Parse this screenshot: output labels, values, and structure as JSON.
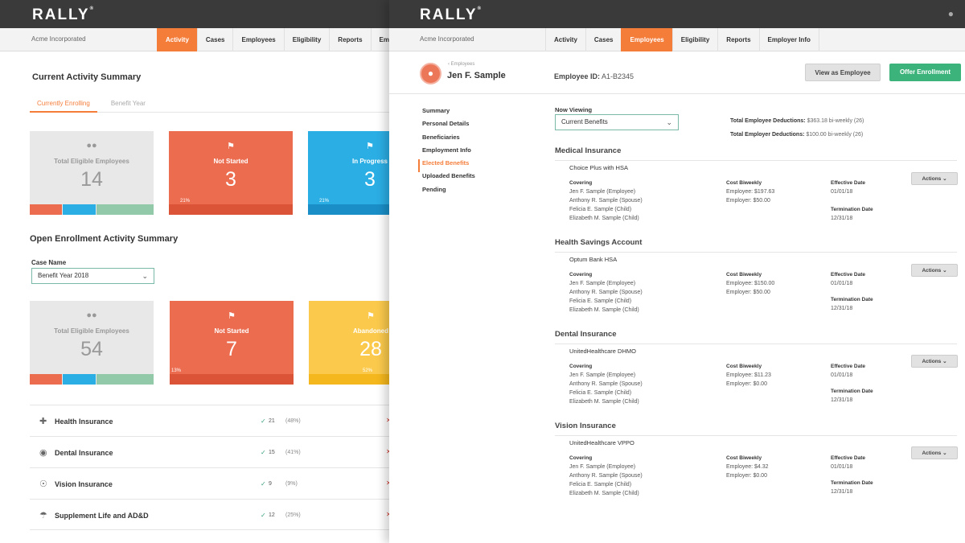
{
  "left": {
    "logo": "RALLY",
    "company": "Acme Incorporated",
    "tabs": [
      "Activity",
      "Cases",
      "Employees",
      "Eligibility",
      "Reports",
      "Emplo"
    ],
    "active_tab": 0,
    "title": "Current Activity Summary",
    "subtabs": [
      "Currently Enrolling",
      "Benefit Year"
    ],
    "cards_top": [
      {
        "label": "Total Eligible Employees",
        "value": "14",
        "icon": "people-icon"
      },
      {
        "label": "Not Started",
        "value": "3",
        "pct": "21%",
        "icon": "flag-icon"
      },
      {
        "label": "In Progress",
        "value": "3",
        "pct": "21%",
        "icon": "flag-icon"
      }
    ],
    "title2": "Open Enrollment Activity Summary",
    "case_label": "Case Name",
    "case_value": "Benefit Year 2018",
    "cards_bottom": [
      {
        "label": "Total Eligible Employees",
        "value": "54",
        "icon": "people-icon"
      },
      {
        "label": "Not Started",
        "value": "7",
        "pct": "13%",
        "icon": "flag-icon"
      },
      {
        "label": "Abandoned",
        "value": "28",
        "pct": "52%",
        "icon": "flag-icon"
      }
    ],
    "benefits": [
      {
        "name": "Health Insurance",
        "count": "21",
        "pct": "(48%)",
        "icon": "health-cross-icon"
      },
      {
        "name": "Dental Insurance",
        "count": "15",
        "pct": "(41%)",
        "icon": "tooth-icon"
      },
      {
        "name": "Vision Insurance",
        "count": "9",
        "pct": "(9%)",
        "icon": "eye-icon"
      },
      {
        "name": "Supplement Life and AD&D",
        "count": "12",
        "pct": "(25%)",
        "icon": "umbrella-icon"
      }
    ]
  },
  "right": {
    "logo": "RALLY",
    "company": "Acme Incorporated",
    "tabs": [
      "Activity",
      "Cases",
      "Employees",
      "Eligibility",
      "Reports",
      "Employer Info"
    ],
    "active_tab": 2,
    "breadcrumb": "Employees",
    "employee_name": "Jen F. Sample",
    "employee_id_label": "Employee ID:",
    "employee_id": "A1-B2345",
    "view_button": "View as Employee",
    "offer_button": "Offer Enrollment",
    "side_nav": [
      "Summary",
      "Personal Details",
      "Beneficiaries",
      "Employment Info",
      "Elected Benefits",
      "Uploaded Benefits",
      "Pending"
    ],
    "side_active": 4,
    "now_viewing_label": "Now Viewing",
    "now_viewing_value": "Current Benefits",
    "employee_deductions_label": "Total Employee Deductions:",
    "employee_deductions_value": "$363.18 bi-weekly (26)",
    "employer_deductions_label": "Total Employer Deductions:",
    "employer_deductions_value": "$100.00 bi-weekly (26)",
    "col_covering": "Covering",
    "col_cost": "Cost Biweekly",
    "col_effective": "Effective Date",
    "col_termination": "Termination Date",
    "actions_label": "Actions",
    "sections": [
      {
        "title": "Medical Insurance",
        "plan": "Choice Plus with HSA",
        "covering": [
          "Jen F. Sample (Employee)",
          "Anthony R. Sample (Spouse)",
          "Felicia E. Sample (Child)",
          "Elizabeth M. Sample (Child)"
        ],
        "cost_employee": "Employee: $197.63",
        "cost_employer": "Employer: $50.00",
        "effective": "01/01/18",
        "termination": "12/31/18"
      },
      {
        "title": "Health Savings Account",
        "plan": "Optum Bank HSA",
        "covering": [
          "Jen F. Sample (Employee)",
          "Anthony R. Sample (Spouse)",
          "Felicia E. Sample (Child)",
          "Elizabeth M. Sample (Child)"
        ],
        "cost_employee": "Employee: $150.00",
        "cost_employer": "Employer: $50.00",
        "effective": "01/01/18",
        "termination": "12/31/18"
      },
      {
        "title": "Dental Insurance",
        "plan": "UnitedHealthcare DHMO",
        "covering": [
          "Jen F. Sample (Employee)",
          "Anthony R. Sample (Spouse)",
          "Felicia E. Sample (Child)",
          "Elizabeth M. Sample (Child)"
        ],
        "cost_employee": "Employee: $11.23",
        "cost_employer": "Employer: $0.00",
        "effective": "01/01/18",
        "termination": "12/31/18"
      },
      {
        "title": "Vision Insurance",
        "plan": "UnitedHealthcare VPPO",
        "covering": [
          "Jen F. Sample (Employee)",
          "Anthony R. Sample (Spouse)",
          "Felicia E. Sample (Child)",
          "Elizabeth M. Sample (Child)"
        ],
        "cost_employee": "Employee: $4.32",
        "cost_employer": "Employer: $0.00",
        "effective": "01/01/18",
        "termination": "12/31/18"
      }
    ]
  },
  "colors": {
    "accent": "#f47d3a",
    "red": "#ec6c4f",
    "blue": "#2baee4",
    "yellow": "#fbca4c",
    "green": "#3db37c",
    "teal_segment": "#92c9a8"
  }
}
